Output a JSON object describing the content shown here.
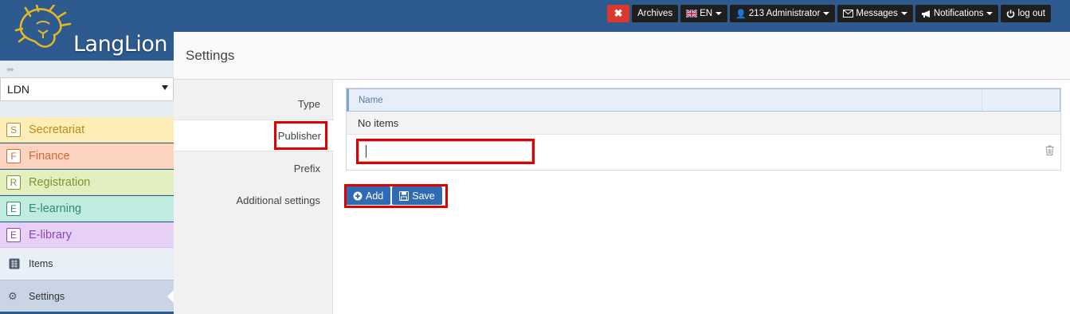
{
  "app": {
    "logo_text": "LangLion"
  },
  "topbar": {
    "close_label": "✖",
    "archives": "Archives",
    "language": "EN",
    "user": "213 Administrator",
    "messages": "Messages",
    "notifications": "Notifications",
    "logout": "log out"
  },
  "sidebar": {
    "library_select": "LDN",
    "modules": [
      {
        "letter": "S",
        "label": "Secretariat",
        "bg": "#fdeeb8",
        "color": "#c18a16"
      },
      {
        "letter": "F",
        "label": "Finance",
        "bg": "#fbd3c1",
        "color": "#d46a3b"
      },
      {
        "letter": "R",
        "label": "Registration",
        "bg": "#e3efbe",
        "color": "#7d9630"
      },
      {
        "letter": "E",
        "label": "E-learning",
        "bg": "#c0ebe1",
        "color": "#2f8c74"
      },
      {
        "letter": "E",
        "label": "E-library",
        "bg": "#e6d0f6",
        "color": "#8c45b8"
      }
    ],
    "items_label": "Items",
    "settings_label": "Settings"
  },
  "page": {
    "title": "Settings"
  },
  "subnav": {
    "type": "Type",
    "publisher": "Publisher",
    "prefix": "Prefix",
    "additional": "Additional settings"
  },
  "table": {
    "header_name": "Name",
    "empty_text": "No items",
    "input_value": ""
  },
  "buttons": {
    "add": "Add",
    "save": "Save"
  }
}
